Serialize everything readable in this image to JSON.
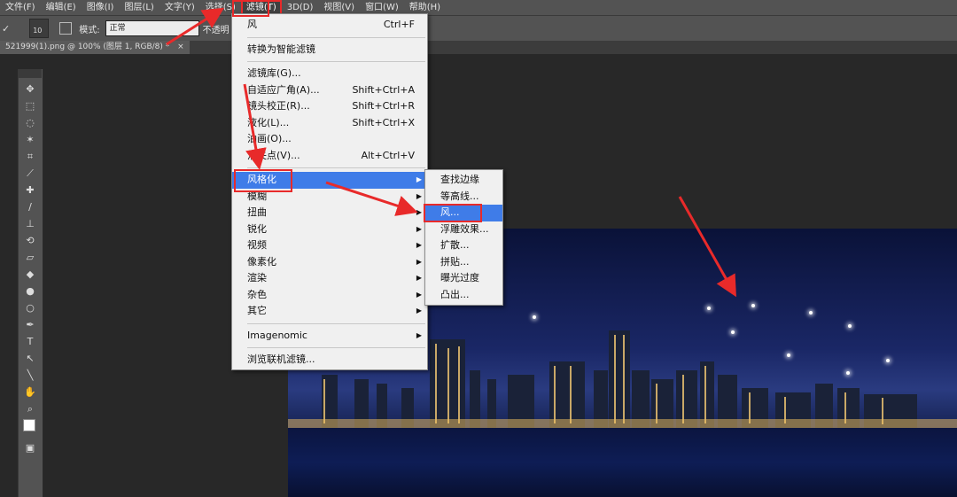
{
  "menubar": {
    "items": [
      {
        "label": "文件(F)"
      },
      {
        "label": "编辑(E)"
      },
      {
        "label": "图像(I)"
      },
      {
        "label": "图层(L)"
      },
      {
        "label": "文字(Y)"
      },
      {
        "label": "选择(S)"
      },
      {
        "label": "滤镜(T)"
      },
      {
        "label": "3D(D)"
      },
      {
        "label": "视图(V)"
      },
      {
        "label": "窗口(W)"
      },
      {
        "label": "帮助(H)"
      }
    ]
  },
  "options": {
    "brush_size": "10",
    "mode_label": "模式:",
    "mode_value": "正常",
    "opacity_label": "不透明"
  },
  "document_tab": {
    "label": "521999(1).png @ 100% (图层 1, RGB/8) *",
    "close": "×"
  },
  "filter_menu": {
    "items": [
      {
        "label": "风",
        "shortcut": "Ctrl+F"
      },
      {
        "label": "转换为智能滤镜",
        "shortcut": ""
      },
      {
        "label": "滤镜库(G)...",
        "shortcut": ""
      },
      {
        "label": "自适应广角(A)...",
        "shortcut": "Shift+Ctrl+A"
      },
      {
        "label": "镜头校正(R)...",
        "shortcut": "Shift+Ctrl+R"
      },
      {
        "label": "液化(L)...",
        "shortcut": "Shift+Ctrl+X"
      },
      {
        "label": "油画(O)...",
        "shortcut": ""
      },
      {
        "label": "消失点(V)...",
        "shortcut": "Alt+Ctrl+V"
      },
      {
        "label": "风格化",
        "shortcut": ""
      },
      {
        "label": "模糊",
        "shortcut": ""
      },
      {
        "label": "扭曲",
        "shortcut": ""
      },
      {
        "label": "锐化",
        "shortcut": ""
      },
      {
        "label": "视频",
        "shortcut": ""
      },
      {
        "label": "像素化",
        "shortcut": ""
      },
      {
        "label": "渲染",
        "shortcut": ""
      },
      {
        "label": "杂色",
        "shortcut": ""
      },
      {
        "label": "其它",
        "shortcut": ""
      },
      {
        "label": "Imagenomic",
        "shortcut": ""
      },
      {
        "label": "浏览联机滤镜...",
        "shortcut": ""
      }
    ]
  },
  "stylize_submenu": {
    "items": [
      {
        "label": "查找边缘"
      },
      {
        "label": "等高线..."
      },
      {
        "label": "风..."
      },
      {
        "label": "浮雕效果..."
      },
      {
        "label": "扩散..."
      },
      {
        "label": "拼贴..."
      },
      {
        "label": "曝光过度"
      },
      {
        "label": "凸出..."
      }
    ]
  },
  "colors": {
    "menubar_bg": "#535353",
    "menu_bg": "#f0f0f0",
    "highlight": "#3f7ce8",
    "annotation_red": "#e82a2a"
  }
}
